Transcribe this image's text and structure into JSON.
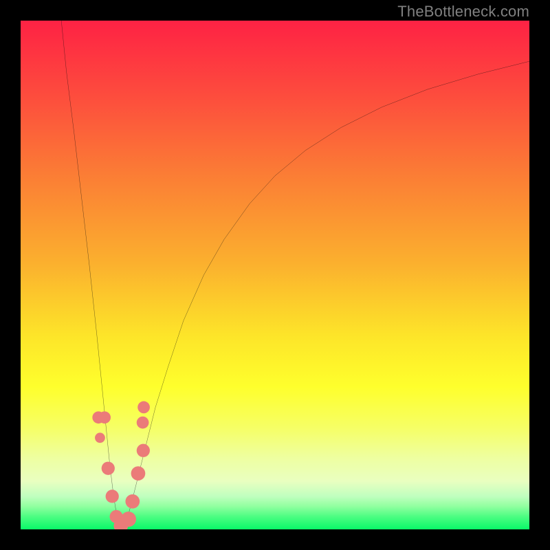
{
  "watermark": {
    "text": "TheBottleneck.com"
  },
  "chart_data": {
    "type": "line",
    "title": "",
    "xlabel": "",
    "ylabel": "",
    "xlim": [
      0,
      100
    ],
    "ylim": [
      0,
      100
    ],
    "grid": false,
    "legend": false,
    "gradient_stops": [
      {
        "offset": 0.0,
        "color": "#fe2244"
      },
      {
        "offset": 0.15,
        "color": "#fd4d3d"
      },
      {
        "offset": 0.3,
        "color": "#fb7c35"
      },
      {
        "offset": 0.48,
        "color": "#fbb12e"
      },
      {
        "offset": 0.62,
        "color": "#fde529"
      },
      {
        "offset": 0.72,
        "color": "#feff2c"
      },
      {
        "offset": 0.8,
        "color": "#f6ff65"
      },
      {
        "offset": 0.86,
        "color": "#eeffa1"
      },
      {
        "offset": 0.905,
        "color": "#e9ffc0"
      },
      {
        "offset": 0.935,
        "color": "#c0ffbf"
      },
      {
        "offset": 0.955,
        "color": "#90ff9f"
      },
      {
        "offset": 0.975,
        "color": "#4cfd82"
      },
      {
        "offset": 1.0,
        "color": "#09f868"
      }
    ],
    "series": [
      {
        "name": "left-branch",
        "x": [
          8.0,
          9.0,
          10.5,
          12.0,
          13.5,
          15.0,
          16.0,
          16.8,
          17.5,
          18.1,
          18.6,
          19.1,
          19.6,
          20.0
        ],
        "y": [
          100.0,
          90.0,
          78.0,
          65.0,
          52.0,
          38.0,
          28.0,
          20.0,
          13.0,
          8.0,
          4.5,
          2.0,
          0.7,
          0.0
        ]
      },
      {
        "name": "right-branch",
        "x": [
          20.0,
          20.5,
          21.2,
          22.0,
          23.0,
          24.5,
          26.5,
          29.0,
          32.0,
          36.0,
          40.0,
          45.0,
          50.0,
          56.0,
          63.0,
          71.0,
          80.0,
          90.0,
          100.0
        ],
        "y": [
          0.0,
          1.0,
          3.0,
          6.0,
          10.0,
          16.0,
          24.0,
          32.0,
          41.0,
          50.0,
          57.0,
          64.0,
          69.5,
          74.5,
          79.0,
          83.0,
          86.5,
          89.5,
          92.0
        ]
      }
    ],
    "markers": [
      {
        "x": 15.3,
        "y": 22.0,
        "r": 1.2
      },
      {
        "x": 16.5,
        "y": 22.0,
        "r": 1.2
      },
      {
        "x": 15.6,
        "y": 18.0,
        "r": 1.0
      },
      {
        "x": 17.2,
        "y": 12.0,
        "r": 1.3
      },
      {
        "x": 18.0,
        "y": 6.5,
        "r": 1.3
      },
      {
        "x": 18.8,
        "y": 2.5,
        "r": 1.3
      },
      {
        "x": 19.7,
        "y": 0.7,
        "r": 1.4
      },
      {
        "x": 21.2,
        "y": 2.0,
        "r": 1.5
      },
      {
        "x": 22.0,
        "y": 5.5,
        "r": 1.4
      },
      {
        "x": 23.1,
        "y": 11.0,
        "r": 1.4
      },
      {
        "x": 24.1,
        "y": 15.5,
        "r": 1.3
      },
      {
        "x": 24.0,
        "y": 21.0,
        "r": 1.2
      },
      {
        "x": 24.2,
        "y": 24.0,
        "r": 1.2
      }
    ],
    "marker_color": "#eb7b79",
    "curve_color": "#0b0b0b",
    "curve_width": 2.2
  }
}
